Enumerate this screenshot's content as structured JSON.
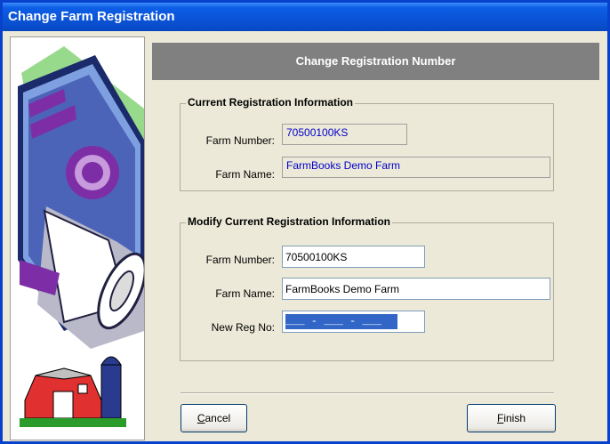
{
  "window": {
    "title": "Change Farm Registration"
  },
  "banner": {
    "title": "Change Registration Number"
  },
  "current": {
    "legend": "Current Registration Information",
    "farm_number_label": "Farm Number:",
    "farm_number_value": "70500100KS",
    "farm_name_label": "Farm Name:",
    "farm_name_value": "FarmBooks Demo Farm"
  },
  "modify": {
    "legend": "Modify Current Registration Information",
    "farm_number_label": "Farm Number:",
    "farm_number_value": "70500100KS",
    "farm_name_label": "Farm Name:",
    "farm_name_value": "FarmBooks Demo Farm",
    "new_reg_label": "New Reg No:",
    "new_reg_mask": "___ - ___ - ___"
  },
  "buttons": {
    "cancel_access": "C",
    "cancel_rest": "ancel",
    "finish_access": "F",
    "finish_rest": "inish"
  },
  "colors": {
    "titlebar": "#0a53d6",
    "banner": "#808080",
    "readonly_text": "#0000cc",
    "selection": "#3166c6"
  }
}
